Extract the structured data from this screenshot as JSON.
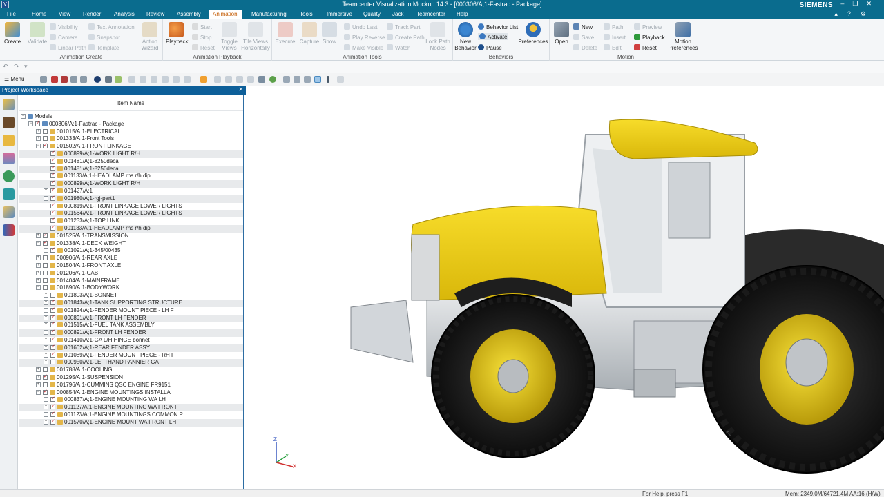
{
  "window": {
    "title": "Teamcenter Visualization Mockup 14.3 - [000306/A;1-Fastrac - Package]",
    "brand": "SIEMENS"
  },
  "menu_tabs": [
    "File",
    "Home",
    "View",
    "Render",
    "Analysis",
    "Review",
    "Assembly",
    "Animation",
    "Manufacturing",
    "Tools",
    "Immersive",
    "Quality",
    "Jack",
    "Teamcenter",
    "Help"
  ],
  "active_tab": "Animation",
  "ribbon": {
    "animation_create": {
      "label": "Animation Create",
      "create": "Create",
      "validate": "Validate",
      "visibility": "Visibility",
      "camera": "Camera",
      "linear_path": "Linear Path",
      "text_annotation": "Text Annotation",
      "snapshot": "Snapshot",
      "template": "Template",
      "action_wizard_1": "Action",
      "action_wizard_2": "Wizard"
    },
    "animation_playback": {
      "label": "Animation Playback",
      "playback": "Playback",
      "start": "Start",
      "stop": "Stop",
      "reset": "Reset",
      "toggle_views_1": "Toggle",
      "toggle_views_2": "Views",
      "tile_views_1": "Tile Views",
      "tile_views_2": "Horizontally"
    },
    "animation_tools": {
      "label": "Animation Tools",
      "execute": "Execute",
      "capture": "Capture",
      "show": "Show",
      "undo_last": "Undo Last",
      "play_reverse": "Play Reverse",
      "make_visible": "Make Visible",
      "track_part": "Track Part",
      "create_path": "Create Path",
      "watch": "Watch",
      "lock_path_1": "Lock Path",
      "lock_path_2": "Nodes"
    },
    "behaviors": {
      "label": "Behaviors",
      "new_behavior_1": "New",
      "new_behavior_2": "Behavior",
      "behavior_list": "Behavior List",
      "activate": "Activate",
      "pause": "Pause",
      "preferences": "Preferences"
    },
    "motion": {
      "label": "Motion",
      "open": "Open",
      "new": "New",
      "save": "Save",
      "delete": "Delete",
      "path": "Path",
      "insert": "Insert",
      "edit": "Edit",
      "preview": "Preview",
      "playback": "Playback",
      "reset": "Reset",
      "motion_prefs_1": "Motion",
      "motion_prefs_2": "Preferences"
    }
  },
  "toolbar": {
    "menu_label": "Menu"
  },
  "workspace": {
    "title": "Project Workspace",
    "column_header": "Item Name",
    "rows": [
      {
        "depth": 0,
        "label": "Models",
        "exp": "-",
        "cb": "none",
        "icon": "pkg"
      },
      {
        "depth": 1,
        "label": "000306/A;1-Fastrac - Package",
        "exp": "-",
        "cb": "chk",
        "icon": "pkg"
      },
      {
        "depth": 2,
        "label": "001015/A;1-ELECTRICAL",
        "exp": "+",
        "cb": "empty",
        "icon": "folder"
      },
      {
        "depth": 2,
        "label": "001333/A;1-Front Tools",
        "exp": "+",
        "cb": "empty",
        "icon": "folder"
      },
      {
        "depth": 2,
        "label": "001502/A;1-FRONT LINKAGE",
        "exp": "-",
        "cb": "chk",
        "icon": "folder"
      },
      {
        "depth": 3,
        "label": "000899/A;1-WORK LIGHT R/H",
        "exp": "",
        "cb": "chk",
        "icon": "folder"
      },
      {
        "depth": 3,
        "label": "001481/A;1-8250decal",
        "exp": "",
        "cb": "chk",
        "icon": "folder"
      },
      {
        "depth": 3,
        "label": "001481/A;1-8250decal",
        "exp": "",
        "cb": "chk",
        "icon": "folder"
      },
      {
        "depth": 3,
        "label": "001133/A;1-HEADLAMP rhs r/h dip",
        "exp": "",
        "cb": "chk",
        "icon": "folder"
      },
      {
        "depth": 3,
        "label": "000899/A;1-WORK LIGHT R/H",
        "exp": "",
        "cb": "chk",
        "icon": "folder"
      },
      {
        "depth": 3,
        "label": "001427/A;1",
        "exp": "+",
        "cb": "chk",
        "icon": "folder"
      },
      {
        "depth": 3,
        "label": "001980/A;1-rgj-part1",
        "exp": "+",
        "cb": "chk",
        "icon": "folder"
      },
      {
        "depth": 3,
        "label": "000819/A;1-FRONT LINKAGE LOWER LIGHTS",
        "exp": "",
        "cb": "chk",
        "icon": "folder"
      },
      {
        "depth": 3,
        "label": "001564/A;1-FRONT LINKAGE LOWER LIGHTS",
        "exp": "",
        "cb": "chk",
        "icon": "folder"
      },
      {
        "depth": 3,
        "label": "001233/A;1-TOP LINK",
        "exp": "",
        "cb": "chk",
        "icon": "folder"
      },
      {
        "depth": 3,
        "label": "001133/A;1-HEADLAMP rhs r/h dip",
        "exp": "",
        "cb": "chk",
        "icon": "folder"
      },
      {
        "depth": 2,
        "label": "001525/A;1-TRANSMISSION",
        "exp": "+",
        "cb": "chk",
        "icon": "folder"
      },
      {
        "depth": 2,
        "label": "001338/A;1-DECK WEIGHT",
        "exp": "-",
        "cb": "chk",
        "icon": "folder"
      },
      {
        "depth": 3,
        "label": "001091/A;1-345/00435",
        "exp": "+",
        "cb": "chk",
        "icon": "folder"
      },
      {
        "depth": 2,
        "label": "000906/A;1-REAR AXLE",
        "exp": "+",
        "cb": "empty",
        "icon": "folder"
      },
      {
        "depth": 2,
        "label": "001504/A;1-FRONT AXLE",
        "exp": "+",
        "cb": "empty",
        "icon": "folder"
      },
      {
        "depth": 2,
        "label": "001206/A;1-CAB",
        "exp": "+",
        "cb": "empty",
        "icon": "folder"
      },
      {
        "depth": 2,
        "label": "001404/A;1-MAINFRAME",
        "exp": "+",
        "cb": "empty",
        "icon": "folder"
      },
      {
        "depth": 2,
        "label": "001890/A;1-BODYWORK",
        "exp": "-",
        "cb": "empty",
        "icon": "folder"
      },
      {
        "depth": 3,
        "label": "001803/A;1-BONNET",
        "exp": "+",
        "cb": "empty",
        "icon": "folder"
      },
      {
        "depth": 3,
        "label": "001843/A;1-TANK SUPPORTING STRUCTURE",
        "exp": "+",
        "cb": "chk",
        "icon": "folder"
      },
      {
        "depth": 3,
        "label": "001824/A;1-FENDER MOUNT PIECE - LH F",
        "exp": "+",
        "cb": "chk",
        "icon": "folder"
      },
      {
        "depth": 3,
        "label": "000891/A;1-FRONT LH FENDER",
        "exp": "+",
        "cb": "chk",
        "icon": "folder"
      },
      {
        "depth": 3,
        "label": "001515/A;1-FUEL TANK ASSEMBLY",
        "exp": "+",
        "cb": "chk",
        "icon": "folder"
      },
      {
        "depth": 3,
        "label": "000891/A;1-FRONT LH FENDER",
        "exp": "+",
        "cb": "chk",
        "icon": "folder"
      },
      {
        "depth": 3,
        "label": "001410/A;1-GA L/H HINGE bonnet",
        "exp": "+",
        "cb": "chk",
        "icon": "folder"
      },
      {
        "depth": 3,
        "label": "001602/A;1-REAR FENDER ASSY",
        "exp": "+",
        "cb": "chk",
        "icon": "folder"
      },
      {
        "depth": 3,
        "label": "001089/A;1-FENDER MOUNT PIECE - RH F",
        "exp": "+",
        "cb": "chk",
        "icon": "folder"
      },
      {
        "depth": 3,
        "label": "000950/A;1-LEFTHAND PANNIER GA",
        "exp": "+",
        "cb": "empty",
        "icon": "folder"
      },
      {
        "depth": 2,
        "label": "001788/A;1-COOLING",
        "exp": "+",
        "cb": "empty",
        "icon": "folder"
      },
      {
        "depth": 2,
        "label": "001295/A;1-SUSPENSION",
        "exp": "+",
        "cb": "chk",
        "icon": "folder"
      },
      {
        "depth": 2,
        "label": "001796/A;1-CUMMINS QSC ENGINE FR9151",
        "exp": "+",
        "cb": "empty",
        "icon": "folder"
      },
      {
        "depth": 2,
        "label": "000854/A;1-ENGINE MOUNTINGS INSTALLA",
        "exp": "-",
        "cb": "chk",
        "icon": "folder"
      },
      {
        "depth": 3,
        "label": "000837/A;1-ENGINE MOUNTING WA LH",
        "exp": "+",
        "cb": "chk",
        "icon": "folder"
      },
      {
        "depth": 3,
        "label": "001127/A;1-ENGINE MOUNTING WA FRONT",
        "exp": "+",
        "cb": "chk",
        "icon": "folder"
      },
      {
        "depth": 3,
        "label": "001123/A;1-ENGINE MOUNTINGS COMMON P",
        "exp": "+",
        "cb": "chk",
        "icon": "folder"
      },
      {
        "depth": 3,
        "label": "001570/A;1-ENGINE MOUNT WA FRONT LH",
        "exp": "+",
        "cb": "chk",
        "icon": "folder"
      }
    ]
  },
  "viewport": {
    "axis_z": "Z",
    "axis_y": "Y",
    "axis_x": "X"
  },
  "status": {
    "help": "For Help, press F1",
    "memory": "Mem: 2349.0M/64721.4M  AA:16 (H/W)"
  },
  "colors": {
    "chrome": "#0a6c8e",
    "accent": "#c35a00",
    "tractor_yellow": "#f2d11a",
    "panel_border": "#2d6da3"
  }
}
